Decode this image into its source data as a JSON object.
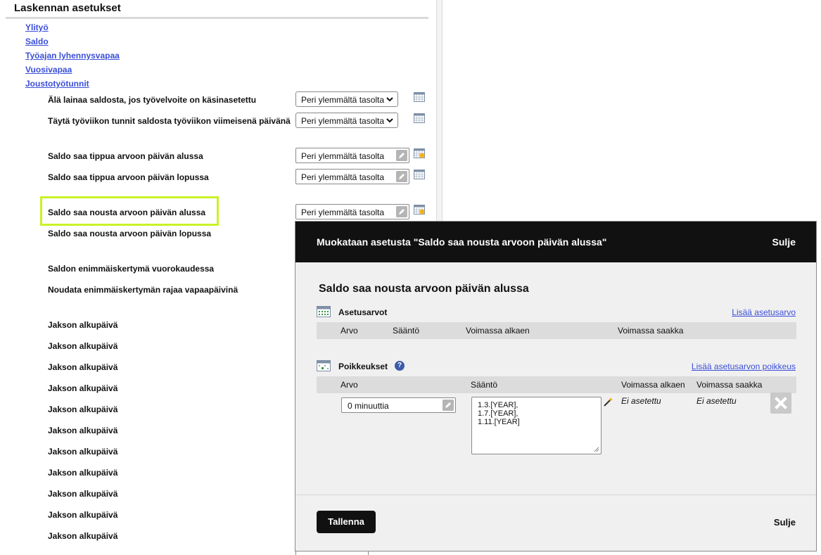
{
  "settings_panel": {
    "title": "Laskennan asetukset",
    "nav_links": [
      "Ylityö",
      "Saldo",
      "Työajan lyhennysvapaa",
      "Vuosivapaa",
      "Joustotyötunnit"
    ],
    "rows": [
      {
        "label": "Älä lainaa saldosta, jos työvelvoite on käsinasetettu",
        "value": "Peri ylemmältä tasolta",
        "control": "select"
      },
      {
        "label": "Täytä työviikon tunnit saldosta työviikon viimeisenä päivänä",
        "value": "Peri ylemmältä tasolta",
        "control": "select"
      },
      {
        "label": "Saldo saa tippua arvoon päivän alussa",
        "value": "Peri ylemmältä tasolta",
        "control": "inherit"
      },
      {
        "label": "Saldo saa tippua arvoon päivän lopussa",
        "value": "Peri ylemmältä tasolta",
        "control": "inherit"
      },
      {
        "label": "Saldo saa nousta arvoon päivän alussa",
        "value": "Peri ylemmältä tasolta",
        "control": "inherit"
      },
      {
        "label": "Saldo saa nousta arvoon päivän lopussa"
      },
      {
        "label": "Saldon enimmäiskertymä vuorokaudessa"
      },
      {
        "label": "Noudata enimmäiskertymän rajaa vapaapäivinä"
      }
    ],
    "period_rows": [
      "Jakson alkupäivä",
      "Jakson alkupäivä",
      "Jakson alkupäivä",
      "Jakson alkupäivä",
      "Jakson alkupäivä",
      "Jakson alkupäivä",
      "Jakson alkupäivä",
      "Jakson alkupäivä",
      "Jakson alkupäivä",
      "Jakson alkupäivä",
      "Jakson alkupäivä"
    ]
  },
  "modal": {
    "title": "Muokataan asetusta \"Saldo saa nousta arvoon päivän alussa\"",
    "close_label": "Sulje",
    "heading": "Saldo saa nousta arvoon päivän alussa",
    "values_section": {
      "title": "Asetusarvot",
      "add_link": "Lisää asetusarvo",
      "columns": [
        "Arvo",
        "Sääntö",
        "Voimassa alkaen",
        "Voimassa saakka"
      ]
    },
    "exceptions_section": {
      "title": "Poikkeukset",
      "help_glyph": "?",
      "add_link": "Lisää asetusarvon poikkeus",
      "columns": [
        "Arvo",
        "Sääntö",
        "Voimassa alkaen",
        "Voimassa saakka"
      ],
      "row": {
        "value": "0 minuuttia",
        "rule_lines": [
          "1.3.[YEAR],",
          "1.7.[YEAR],",
          "1.11.[YEAR]"
        ],
        "valid_from": "Ei asetettu",
        "valid_until": "Ei asetettu"
      }
    },
    "save_label": "Tallenna",
    "close_bottom_label": "Sulje"
  },
  "colors": {
    "link": "#3b4fd8",
    "highlight": "#c9f227",
    "modal_header": "#111111",
    "modal_body": "#f0f0f0"
  }
}
